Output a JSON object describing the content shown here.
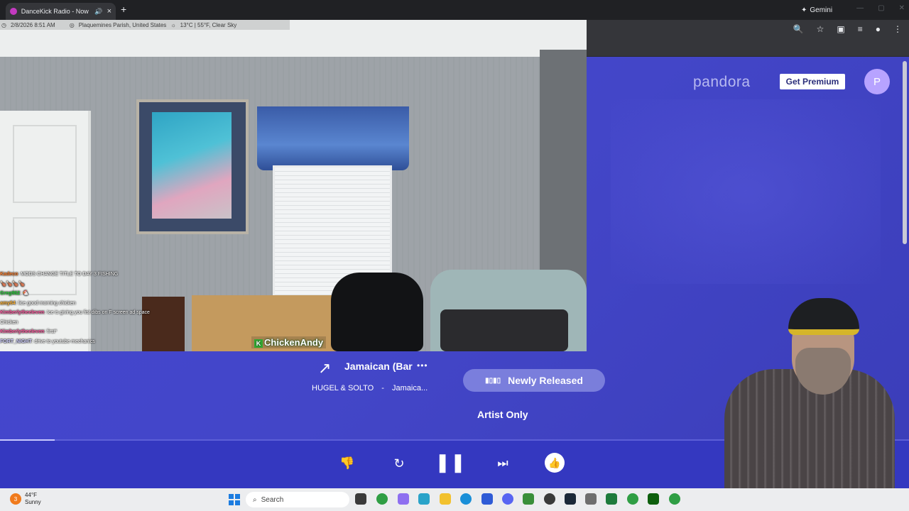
{
  "browser": {
    "tab_title": "DanceKick Radio - Now Playing",
    "tab_audio_icon": "speaker-icon",
    "tab_close": "×",
    "new_tab": "+",
    "gemini_label": "Gemini",
    "gemini_icon": "✦"
  },
  "stream": {
    "datetime": "2/8/2026 8:51 AM",
    "location": "Plaquemines Parish, United States",
    "weather": "13°C | 55°F, Clear Sky",
    "watermark": "ChickenAndy",
    "watermark_badge": "K",
    "chat": [
      {
        "user": "Kadeco",
        "text": "MODS CHANGE TITLE TO DAY 3 FISHING"
      },
      {
        "user": "",
        "text": "🍗🍗🍗🍗"
      },
      {
        "user": "Greg962",
        "text": "🐔"
      },
      {
        "user": "amy64",
        "text": "lice good morning chicken"
      },
      {
        "user": "Kimberlytheeleven",
        "text": "Ice is giving you fist dibs on F screen ad space Chicken"
      },
      {
        "user": "Kimberlytheeleven",
        "text": "first*"
      },
      {
        "user": "FORT_NIGHT",
        "text": "drive to youtube mechanics"
      }
    ]
  },
  "pandora": {
    "logo": "pandora",
    "premium_label": "Get Premium",
    "avatar_letter": "P",
    "track_title": "Jamaican (Bar",
    "artist": "HUGEL & SOLTO",
    "separator": "-",
    "album": "Jamaica...",
    "more": "•••",
    "mode_newly_released": "Newly Released",
    "mode_artist_only": "Artist Only",
    "progress": 0.06
  },
  "taskbar": {
    "weather_temp": "44°F",
    "weather_desc": "Sunny",
    "weather_badge": "3",
    "search_label": "Search"
  }
}
